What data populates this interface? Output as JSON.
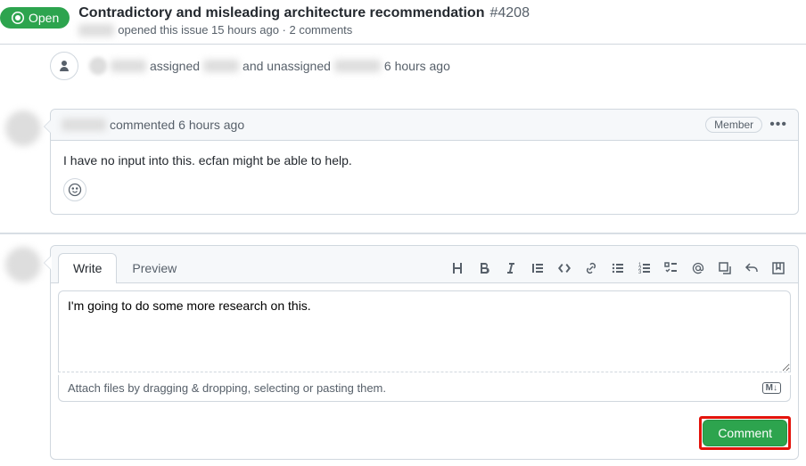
{
  "header": {
    "status_label": "Open",
    "title": "Contradictory and misleading architecture recommendation",
    "issue_number": "#4208",
    "opened_text": "opened this issue 15 hours ago · 2 comments"
  },
  "timeline": {
    "assigned_text": "assigned",
    "unassigned_text": "and unassigned",
    "time": "6 hours ago"
  },
  "comment": {
    "action": "commented",
    "time": "6 hours ago",
    "badge": "Member",
    "body": "I have no input into this. ecfan might be able to help."
  },
  "compose": {
    "tab_write": "Write",
    "tab_preview": "Preview",
    "text": "I'm going to do some more research on this.",
    "attach_hint": "Attach files by dragging & dropping, selecting or pasting them.",
    "md_badge": "M↓",
    "submit_label": "Comment"
  },
  "toolbar_icons": [
    "heading",
    "bold",
    "italic",
    "quote",
    "code",
    "link",
    "ul",
    "ol",
    "tasklist",
    "mention",
    "crossref",
    "reply",
    "saved"
  ]
}
